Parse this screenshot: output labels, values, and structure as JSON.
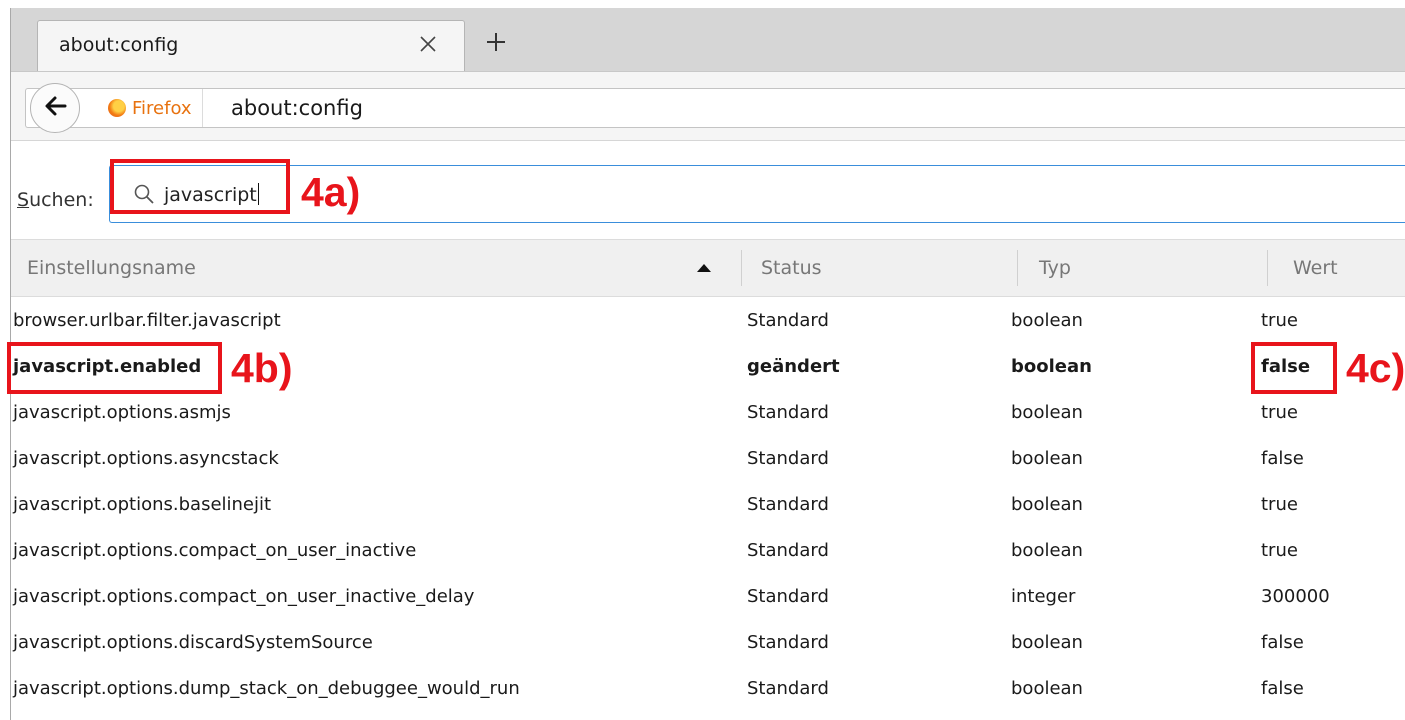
{
  "tab": {
    "title": "about:config"
  },
  "navbar": {
    "identity_label": "Firefox",
    "url": "about:config"
  },
  "search": {
    "label_accesskey": "S",
    "label_rest": "uchen:",
    "value": "javascript"
  },
  "table": {
    "columns": [
      "Einstellungsname",
      "Status",
      "Typ",
      "Wert"
    ],
    "sort_column": "Einstellungsname",
    "rows": [
      {
        "name": "browser.urlbar.filter.javascript",
        "status": "Standard",
        "type": "boolean",
        "value": "true",
        "modified": false
      },
      {
        "name": "javascript.enabled",
        "status": "geändert",
        "type": "boolean",
        "value": "false",
        "modified": true
      },
      {
        "name": "javascript.options.asmjs",
        "status": "Standard",
        "type": "boolean",
        "value": "true",
        "modified": false
      },
      {
        "name": "javascript.options.asyncstack",
        "status": "Standard",
        "type": "boolean",
        "value": "false",
        "modified": false
      },
      {
        "name": "javascript.options.baselinejit",
        "status": "Standard",
        "type": "boolean",
        "value": "true",
        "modified": false
      },
      {
        "name": "javascript.options.compact_on_user_inactive",
        "status": "Standard",
        "type": "boolean",
        "value": "true",
        "modified": false
      },
      {
        "name": "javascript.options.compact_on_user_inactive_delay",
        "status": "Standard",
        "type": "integer",
        "value": "300000",
        "modified": false
      },
      {
        "name": "javascript.options.discardSystemSource",
        "status": "Standard",
        "type": "boolean",
        "value": "false",
        "modified": false
      },
      {
        "name": "javascript.options.dump_stack_on_debuggee_would_run",
        "status": "Standard",
        "type": "boolean",
        "value": "false",
        "modified": false
      }
    ]
  },
  "annotations": {
    "label_4a": "4a)",
    "label_4b": "4b)",
    "label_4c": "4c)",
    "color": "#e8141b"
  },
  "icons": {
    "close": "close-icon",
    "new_tab": "plus-icon",
    "back": "back-arrow-icon",
    "identity": "firefox-logo-icon",
    "search": "search-icon",
    "sort": "sort-ascending-icon"
  }
}
